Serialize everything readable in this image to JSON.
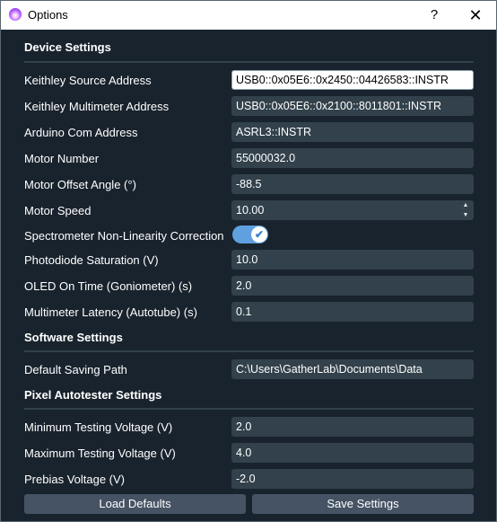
{
  "window": {
    "title": "Options",
    "help_icon": "?",
    "close_icon": "✕"
  },
  "sections": {
    "device": "Device Settings",
    "software": "Software Settings",
    "autotester": "Pixel Autotester Settings"
  },
  "device": {
    "keithley_source_label": "Keithley Source Address",
    "keithley_source_value": "USB0::0x05E6::0x2450::04426583::INSTR",
    "keithley_multimeter_label": "Keithley Multimeter Address",
    "keithley_multimeter_value": "USB0::0x05E6::0x2100::8011801::INSTR",
    "arduino_label": "Arduino Com Address",
    "arduino_value": "ASRL3::INSTR",
    "motor_number_label": "Motor Number",
    "motor_number_value": "55000032.0",
    "motor_offset_label": "Motor Offset Angle (°)",
    "motor_offset_value": "-88.5",
    "motor_speed_label": "Motor Speed",
    "motor_speed_value": "10.00",
    "spectrometer_label": "Spectrometer Non-Linearity Correction",
    "spectrometer_enabled": true,
    "photodiode_label": "Photodiode Saturation (V)",
    "photodiode_value": "10.0",
    "oled_label": "OLED On Time (Goniometer) (s)",
    "oled_value": "2.0",
    "multimeter_latency_label": "Multimeter Latency (Autotube) (s)",
    "multimeter_latency_value": "0.1"
  },
  "software": {
    "saving_path_label": "Default Saving Path",
    "saving_path_value": "C:\\Users\\GatherLab\\Documents\\Data"
  },
  "autotester": {
    "min_voltage_label": "Minimum Testing Voltage (V)",
    "min_voltage_value": "2.0",
    "max_voltage_label": "Maximum Testing Voltage (V)",
    "max_voltage_value": "4.0",
    "prebias_label": "Prebias Voltage (V)",
    "prebias_value": "-2.0"
  },
  "buttons": {
    "load_defaults": "Load Defaults",
    "save_settings": "Save Settings"
  },
  "colors": {
    "background": "#19232d",
    "field": "#32414b",
    "button": "#455364",
    "toggle": "#60a0e0"
  }
}
